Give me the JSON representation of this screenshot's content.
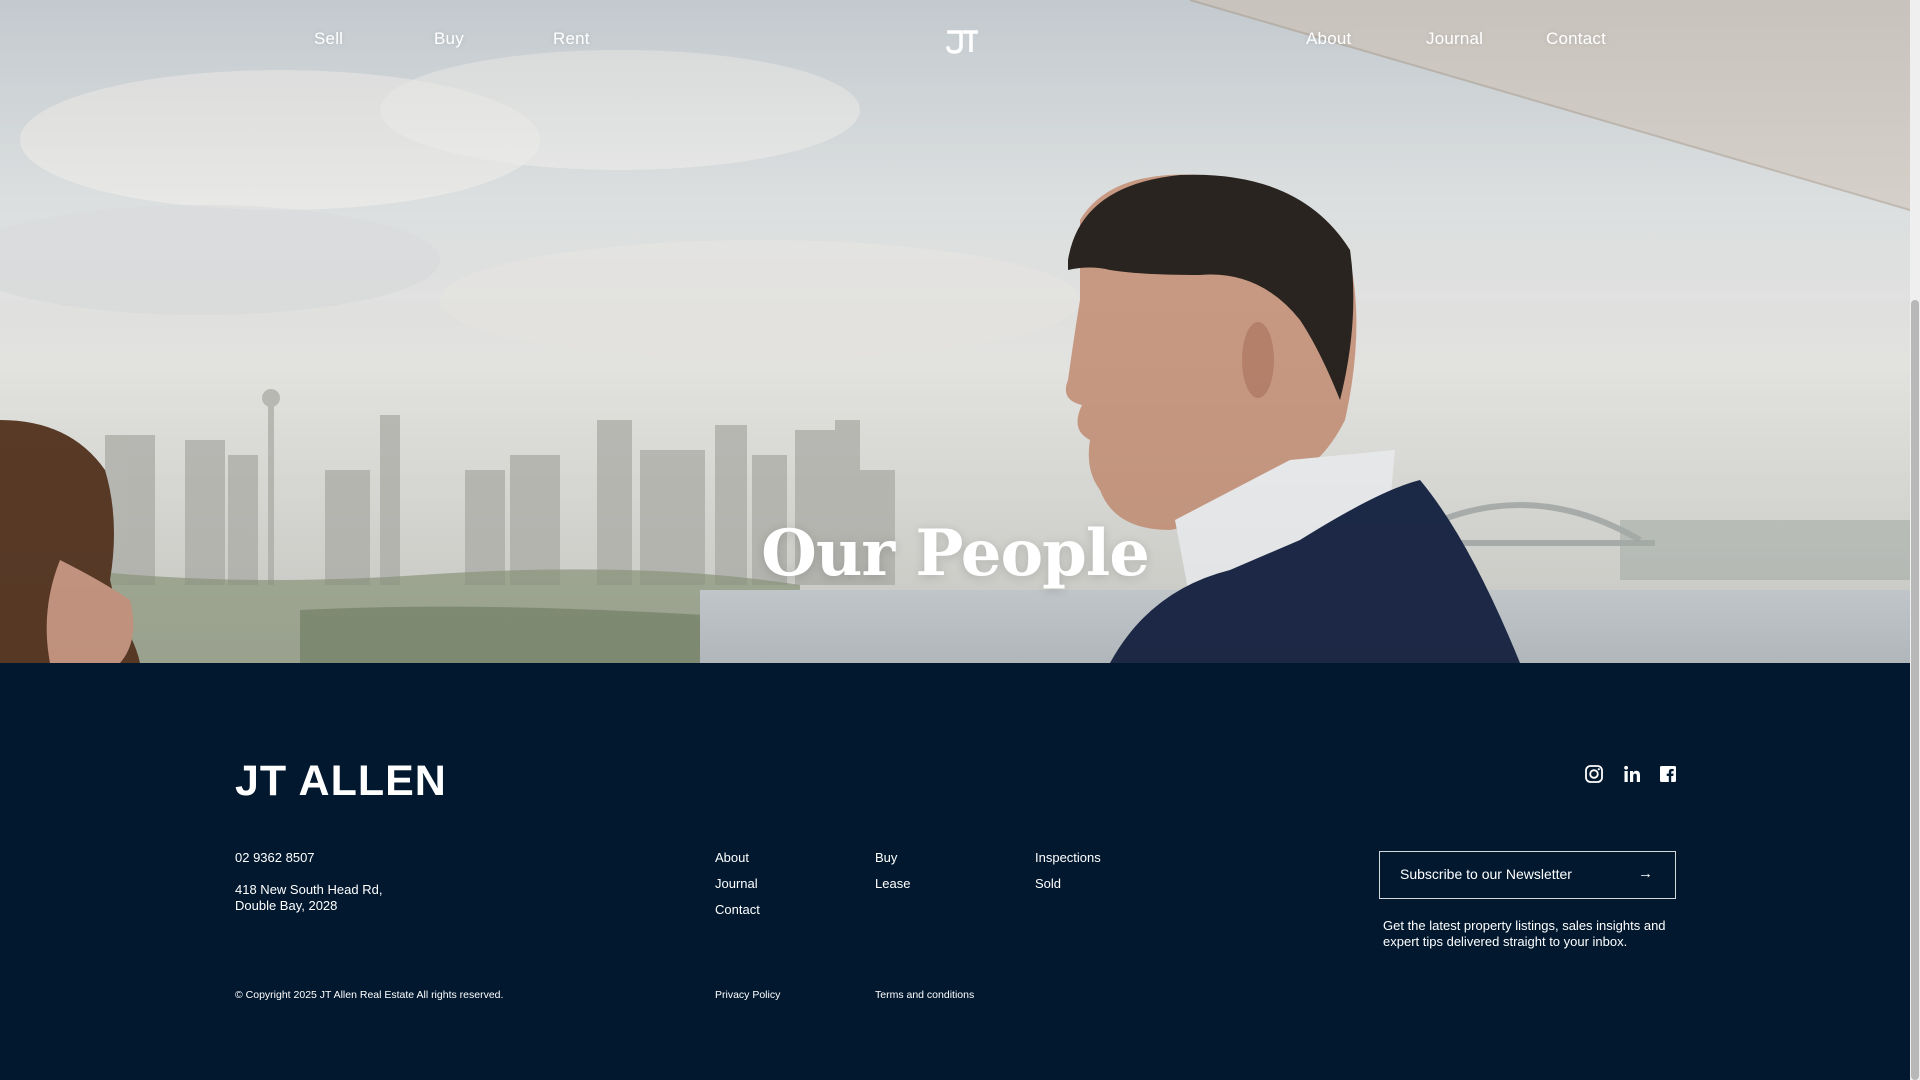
{
  "nav": {
    "left": [
      {
        "label": "Sell"
      },
      {
        "label": "Buy"
      },
      {
        "label": "Rent"
      }
    ],
    "right": [
      {
        "label": "About"
      },
      {
        "label": "Journal"
      },
      {
        "label": "Contact"
      }
    ],
    "logo_icon": "jt-monogram-icon"
  },
  "hero": {
    "title": "Our People"
  },
  "footer": {
    "brand": "JT ALLEN",
    "social": [
      "instagram-icon",
      "linkedin-icon",
      "facebook-icon"
    ],
    "phone": "02 9362 8507",
    "address_line1": "418 New South Head Rd,",
    "address_line2": "Double Bay, 2028",
    "links": {
      "about": "About",
      "journal": "Journal",
      "contact": "Contact",
      "buy": "Buy",
      "lease": "Lease",
      "inspections": "Inspections",
      "sold": "Sold"
    },
    "newsletter": {
      "label": "Subscribe to our Newsletter",
      "arrow": "→",
      "description": "Get the latest property listings, sales insights and expert tips delivered straight to your inbox."
    },
    "copyright": "© Copyright 2025 JT Allen Real Estate All rights reserved.",
    "privacy": "Privacy Policy",
    "terms": "Terms and conditions"
  },
  "colors": {
    "footer_bg": "#02182f",
    "text": "#ffffff"
  }
}
